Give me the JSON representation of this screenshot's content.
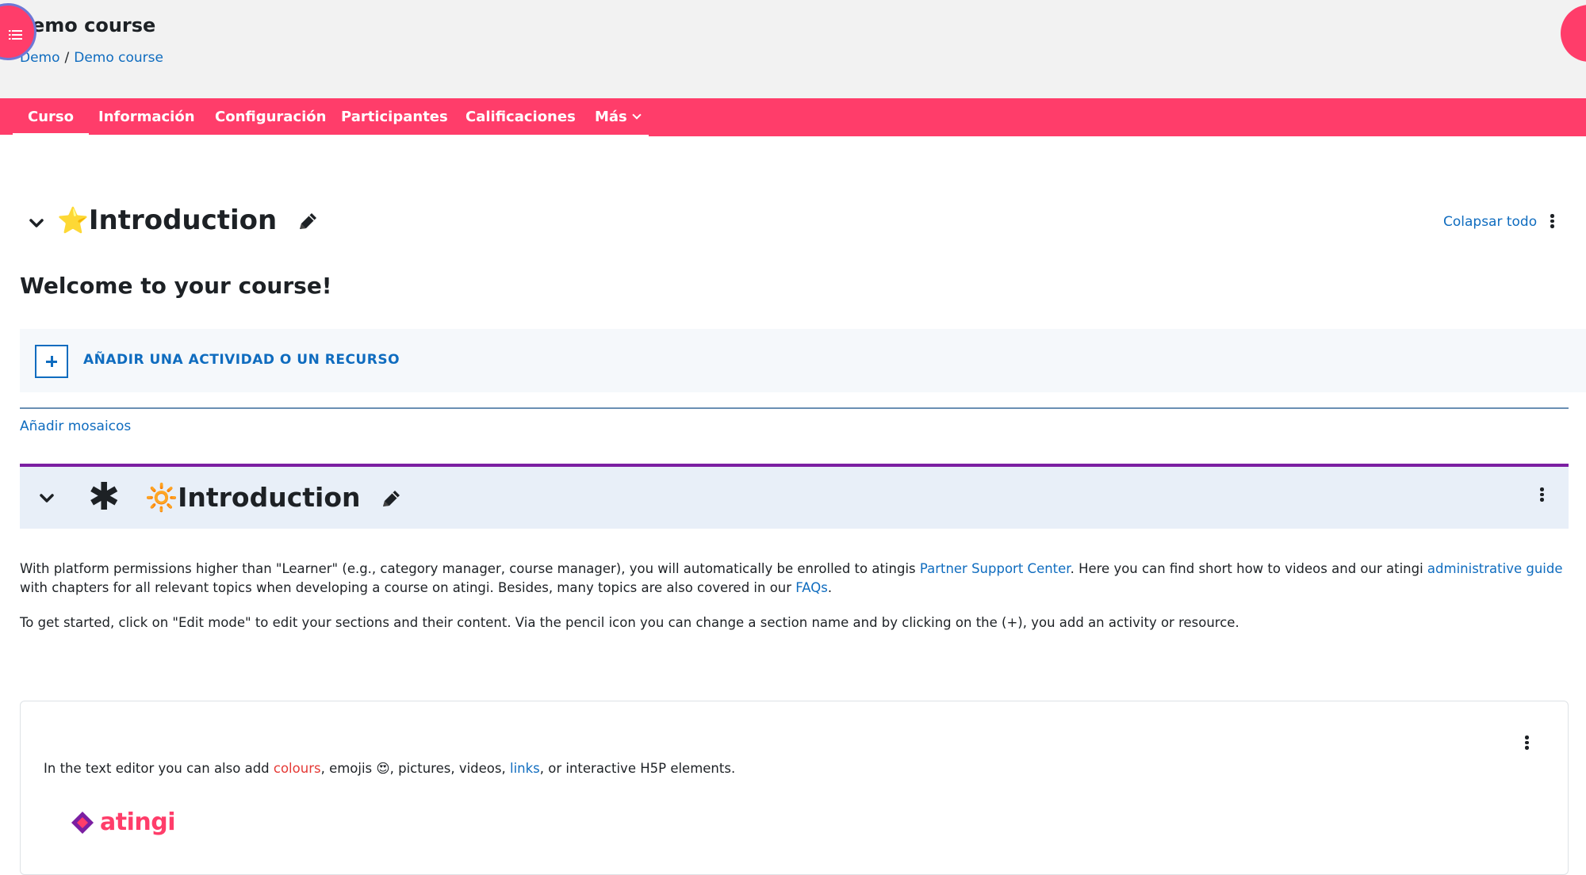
{
  "header": {
    "title": "emo course",
    "breadcrumb": [
      {
        "label": "Demo"
      },
      {
        "label": "Demo course"
      }
    ],
    "breadcrumb_separator": "/"
  },
  "nav": {
    "tabs": [
      {
        "label": "Curso",
        "active": true
      },
      {
        "label": "Información"
      },
      {
        "label": "Configuración"
      },
      {
        "label": "Participantes"
      },
      {
        "label": "Calificaciones"
      },
      {
        "label": "Más"
      }
    ]
  },
  "section1": {
    "emoji": "⭐",
    "title": "Introduction",
    "collapse_all": "Colapsar todo",
    "welcome": "Welcome to your course!",
    "add_activity": "AÑADIR UNA ACTIVIDAD O UN RECURSO",
    "add_tiles": "Añadir mosaicos"
  },
  "section2": {
    "emoji": "🔆",
    "asterisk": "✱",
    "title": "Introduction",
    "para1": {
      "t1": "With platform permissions higher than \"Learner\" (e.g., category manager, course manager), you will automatically be enrolled to atingis ",
      "link1": "Partner Support Center",
      "t2": ". Here you can find short how to videos and our atingi ",
      "link2": "administrative guide",
      "t3": " with chapters for all relevant topics when developing a course on atingi. Besides, many topics are also covered in our ",
      "link3": "FAQs",
      "t4": "."
    },
    "para2": "To get started, click on \"Edit mode\" to edit your sections and their content. Via the pencil icon you can change a section name and by clicking on the (+), you add an activity or resource."
  },
  "card": {
    "t1": "In the text editor you can also add ",
    "colours": "colours",
    "t2": ", emojis ",
    "emoji": "😍",
    "t3": ", pictures, videos, ",
    "links": "links",
    "t4": ", or interactive H5P elements.",
    "logo_text": "atingi"
  },
  "colors": {
    "accent": "#ff3d6a",
    "link": "#0f6cbf",
    "section_border": "#7b1fa2"
  }
}
